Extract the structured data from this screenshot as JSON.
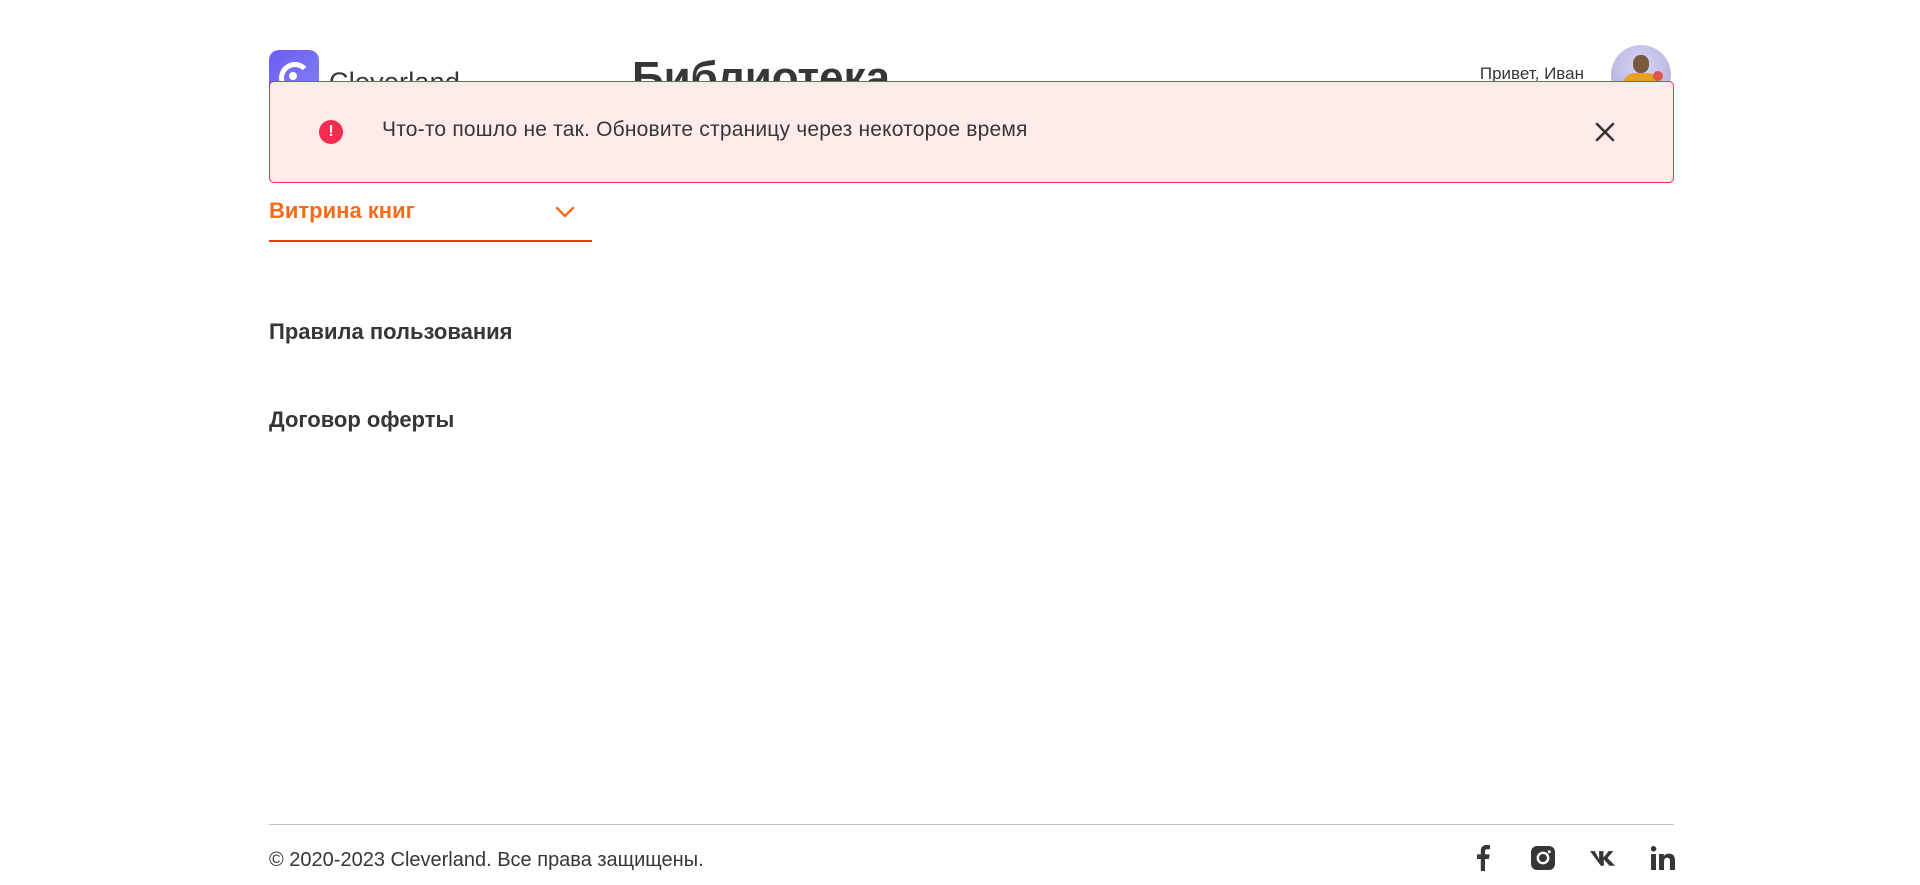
{
  "header": {
    "logo_text": "Cleverland",
    "page_title": "Библиотека",
    "greeting": "Привет, Иван"
  },
  "alert": {
    "icon": "exclamation-icon",
    "icon_glyph": "!",
    "message": "Что-то пошло не так. Обновите страницу через некоторое время",
    "close_icon": "close-icon"
  },
  "nav": {
    "showcase_label": "Витрина книг",
    "rules_label": "Правила пользования",
    "offer_label": "Договор оферты"
  },
  "footer": {
    "copyright": "© 2020-2023 Cleverland. Все права защищены.",
    "socials": [
      "facebook-icon",
      "instagram-icon",
      "vk-icon",
      "linkedin-icon"
    ]
  },
  "colors": {
    "accent": "#f86b1a",
    "alert_bg": "#feebea",
    "alert_border": "#f42c4f",
    "text": "#363636"
  }
}
